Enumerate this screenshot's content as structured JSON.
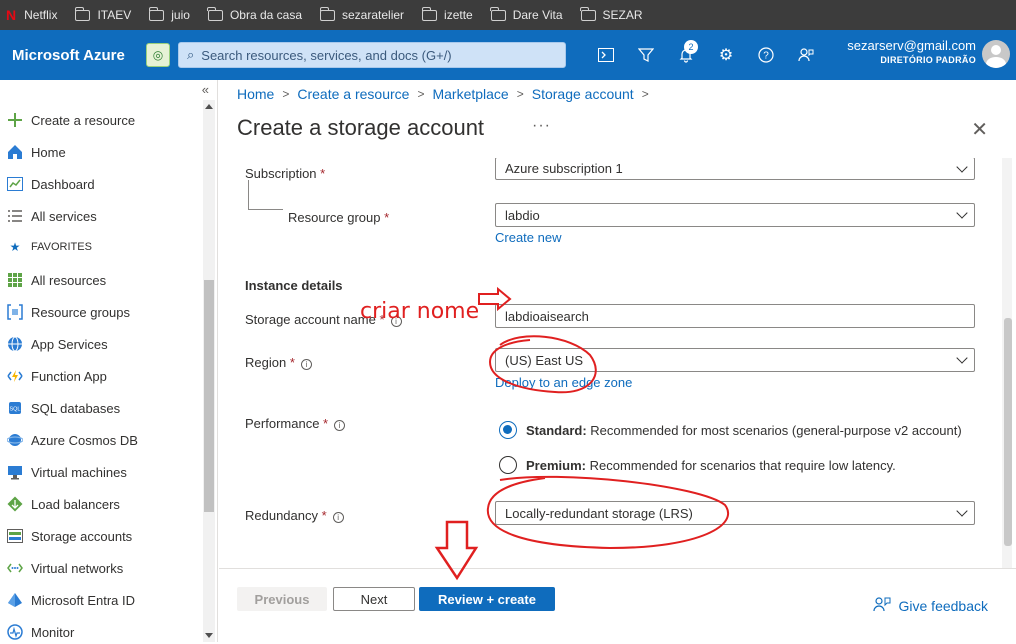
{
  "bookmarks": [
    {
      "label": "Netflix",
      "icon": "netflix-icon"
    },
    {
      "label": "ITAEV",
      "icon": "folder-icon"
    },
    {
      "label": "juio",
      "icon": "folder-icon"
    },
    {
      "label": "Obra da casa",
      "icon": "folder-icon"
    },
    {
      "label": "sezaratelier",
      "icon": "folder-icon"
    },
    {
      "label": "izette",
      "icon": "folder-icon"
    },
    {
      "label": "Dare Vita",
      "icon": "folder-icon"
    },
    {
      "label": "SEZAR",
      "icon": "folder-icon"
    }
  ],
  "topbar": {
    "brand": "Microsoft Azure",
    "search_placeholder": "Search resources, services, and docs (G+/)",
    "notifications_count": "2",
    "email": "sezarserv@gmail.com",
    "directory": "DIRETÓRIO PADRÃO"
  },
  "sidebar": {
    "items": [
      {
        "label": "Create a resource",
        "icon": "plus-icon"
      },
      {
        "label": "Home",
        "icon": "home-icon"
      },
      {
        "label": "Dashboard",
        "icon": "dashboard-icon"
      },
      {
        "label": "All services",
        "icon": "list-icon"
      },
      {
        "label": "FAVORITES",
        "icon": "star-icon"
      },
      {
        "label": "All resources",
        "icon": "grid-icon"
      },
      {
        "label": "Resource groups",
        "icon": "resource-group-icon"
      },
      {
        "label": "App Services",
        "icon": "globe-icon"
      },
      {
        "label": "Function App",
        "icon": "lightning-icon"
      },
      {
        "label": "SQL databases",
        "icon": "sql-icon"
      },
      {
        "label": "Azure Cosmos DB",
        "icon": "cosmos-icon"
      },
      {
        "label": "Virtual machines",
        "icon": "vm-icon"
      },
      {
        "label": "Load balancers",
        "icon": "load-balancer-icon"
      },
      {
        "label": "Storage accounts",
        "icon": "storage-icon"
      },
      {
        "label": "Virtual networks",
        "icon": "network-icon"
      },
      {
        "label": "Microsoft Entra ID",
        "icon": "entra-icon"
      },
      {
        "label": "Monitor",
        "icon": "monitor-icon"
      }
    ]
  },
  "breadcrumb": [
    "Home",
    "Create a resource",
    "Marketplace",
    "Storage account"
  ],
  "page": {
    "title": "Create a storage account",
    "more": "···"
  },
  "form": {
    "subscription_label": "Subscription",
    "subscription_value": "Azure subscription 1",
    "resource_group_label": "Resource group",
    "resource_group_value": "labdio",
    "create_new": "Create new",
    "instance_details": "Instance details",
    "storage_name_label": "Storage account name",
    "storage_name_value": "labdioaisearch",
    "region_label": "Region",
    "region_value": "(US) East US",
    "edge_zone_link": "Deploy to an edge zone",
    "performance_label": "Performance",
    "standard_title": "Standard:",
    "standard_desc": "Recommended for most scenarios (general-purpose v2 account)",
    "premium_title": "Premium:",
    "premium_desc": "Recommended for scenarios that require low latency.",
    "performance_selected": "Standard",
    "redundancy_label": "Redundancy",
    "redundancy_value": "Locally-redundant storage (LRS)",
    "required_mark": "*"
  },
  "footer": {
    "previous": "Previous",
    "next": "Next",
    "review": "Review + create",
    "feedback": "Give feedback"
  },
  "annotations": {
    "note": "criar nome",
    "color": "#e02020"
  },
  "colors": {
    "azure_blue": "#0f6cbd",
    "bookmark_bar": "#3c3c3c"
  }
}
